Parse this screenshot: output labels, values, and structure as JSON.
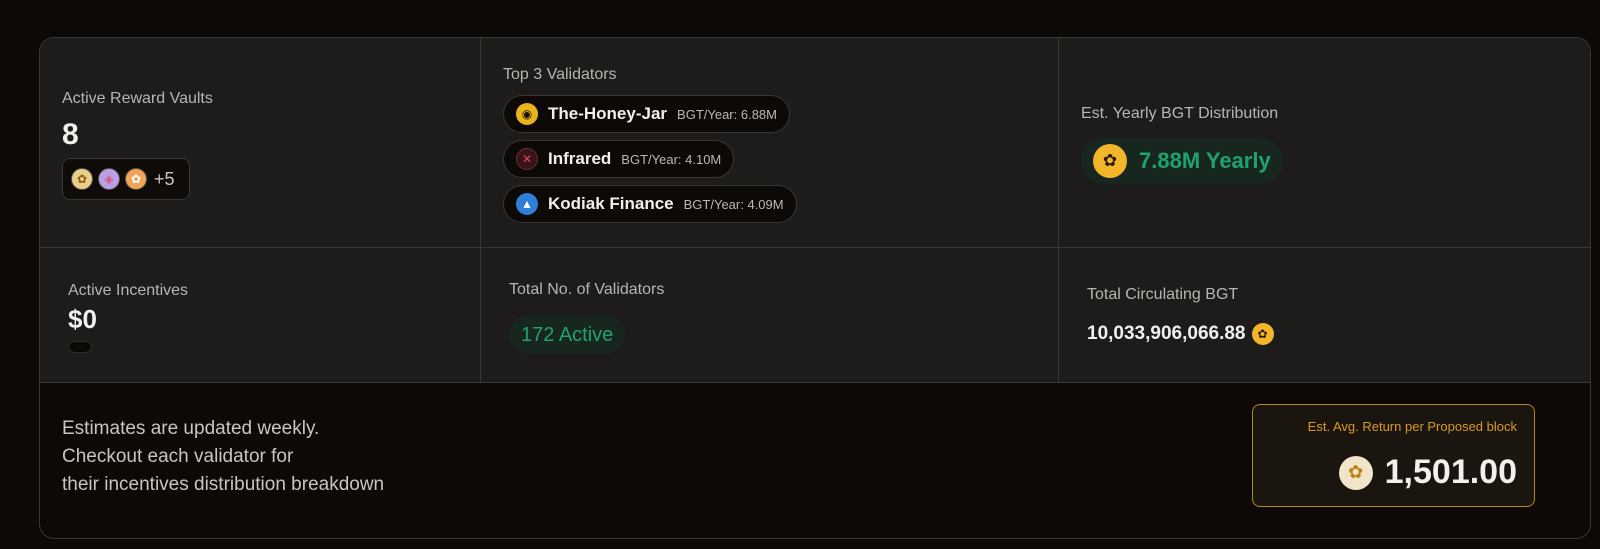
{
  "vaults": {
    "label": "Active Reward Vaults",
    "count": "8",
    "icons": [
      "honeycomb-token-icon",
      "pink-token-icon",
      "orange-token-icon"
    ],
    "more": "+5"
  },
  "validators": {
    "label": "Top 3 Validators",
    "items": [
      {
        "name": "The-Honey-Jar",
        "stat": "BGT/Year: 6.88M",
        "icon": "honey-jar-icon"
      },
      {
        "name": "Infrared",
        "stat": "BGT/Year: 4.10M",
        "icon": "infrared-icon"
      },
      {
        "name": "Kodiak Finance",
        "stat": "BGT/Year: 4.09M",
        "icon": "kodiak-icon"
      }
    ]
  },
  "distribution": {
    "label": "Est. Yearly BGT Distribution",
    "value": "7.88M Yearly"
  },
  "incentives": {
    "label": "Active Incentives",
    "value": "$0"
  },
  "total_validators": {
    "label": "Total No. of Validators",
    "value": "172 Active"
  },
  "circulating": {
    "label": "Total Circulating BGT",
    "value": "10,033,906,066.88"
  },
  "footer": {
    "line1": "Estimates are updated weekly.",
    "line2": "Checkout each validator for",
    "line3": "their incentives distribution breakdown"
  },
  "avg_return": {
    "label": "Est. Avg. Return per Proposed block",
    "value": "1,501.00"
  },
  "colors": {
    "accent_green": "#1fa36b",
    "bgt_gold": "#f3b52a",
    "border_gold": "#b8861f"
  }
}
